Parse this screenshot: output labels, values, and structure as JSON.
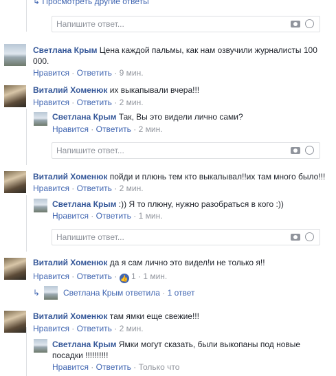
{
  "top_link": "Просмотреть другие ответы",
  "input_placeholder": "Напишите ответ...",
  "actions": {
    "like": "Нравится",
    "reply": "Ответить"
  },
  "comments": [
    {
      "author": "Светлана Крым",
      "text": "Цена каждой пальмы, как нам озвучили журналисты 100",
      "text2": "000.",
      "time": "9 мин."
    },
    {
      "author": "Виталий Хоменюк",
      "text": "их выкапывали вчера!!!",
      "time": "2 мин."
    },
    {
      "author": "Светлана Крым",
      "text": "Так, Вы это видели лично сами?",
      "time": "2 мин."
    },
    {
      "author": "Виталий Хоменюк",
      "text": "пойди и плюнь тем кто выкапывал!!их там много было!!!",
      "time": "2 мин."
    },
    {
      "author": "Светлана Крым",
      "text": ":)) Я то плюну, нужно разобраться в кого :))",
      "time": "1 мин."
    },
    {
      "author": "Виталий Хоменюк",
      "text": "да я сам лично это видел!и не только я!!",
      "time": "1 мин.",
      "likes": "1"
    },
    {
      "author": "Виталий Хоменюк",
      "text": "там ямки еще свежие!!!",
      "time": "2 мин."
    },
    {
      "author": "Светлана Крым",
      "text": "Ямки могут сказать, были выкопаны под новые",
      "text2": "посадки !!!!!!!!!!",
      "time": "Только что"
    }
  ],
  "replies_summary": {
    "author": "Светлана Крым",
    "text": "ответила",
    "count": "1 ответ"
  },
  "icons": {
    "camera": "camera-icon",
    "emoji": "smiley-icon",
    "like_badge": "thumbs-up-icon",
    "reply_arrow": "reply-arrow-icon"
  }
}
